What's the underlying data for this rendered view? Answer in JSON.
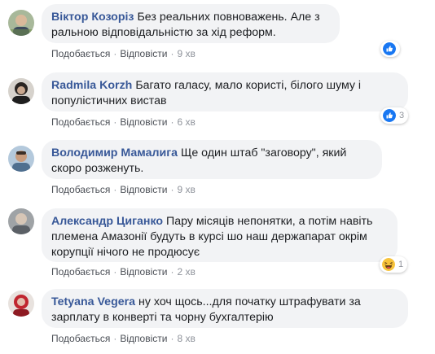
{
  "labels": {
    "like": "Подобається",
    "reply": "Відповісти",
    "sep": "·"
  },
  "colors": {
    "author": "#385898",
    "bubble": "#f2f3f5",
    "meta": "#90949c",
    "like_blue": "#1877f2"
  },
  "comments": [
    {
      "author": "Віктор Козоріз",
      "text": "Без реальних повноважень. Але з ральною відповідальністю за хід реформ.",
      "time": "9 хв",
      "reactions": {
        "icon": "like-icon",
        "count": ""
      }
    },
    {
      "author": "Radmila Korzh",
      "text": "Багато галасу, мало користі, білого шуму і популістичних вистав",
      "time": "6 хв",
      "reactions": {
        "icon": "like-icon",
        "count": "3"
      }
    },
    {
      "author": "Володимир Мамалига",
      "text": "Ще один штаб \"заговору\", який скоро розженуть.",
      "time": "9 хв",
      "reactions": null
    },
    {
      "author": "Александр Циганко",
      "text": "Пару місяців непонятки, а потім навіть племена Амазонії будуть в курсі шо наш держапарат окрім корупції нічого не продюсує",
      "time": "2 хв",
      "reactions": {
        "icon": "haha-icon",
        "count": "1"
      }
    },
    {
      "author": "Tetyana Vegera",
      "text": "ну хоч щось...для початку штрафувати за зарплату в конверті та чорну бухгалтерію",
      "time": "8 хв",
      "reactions": null
    }
  ]
}
